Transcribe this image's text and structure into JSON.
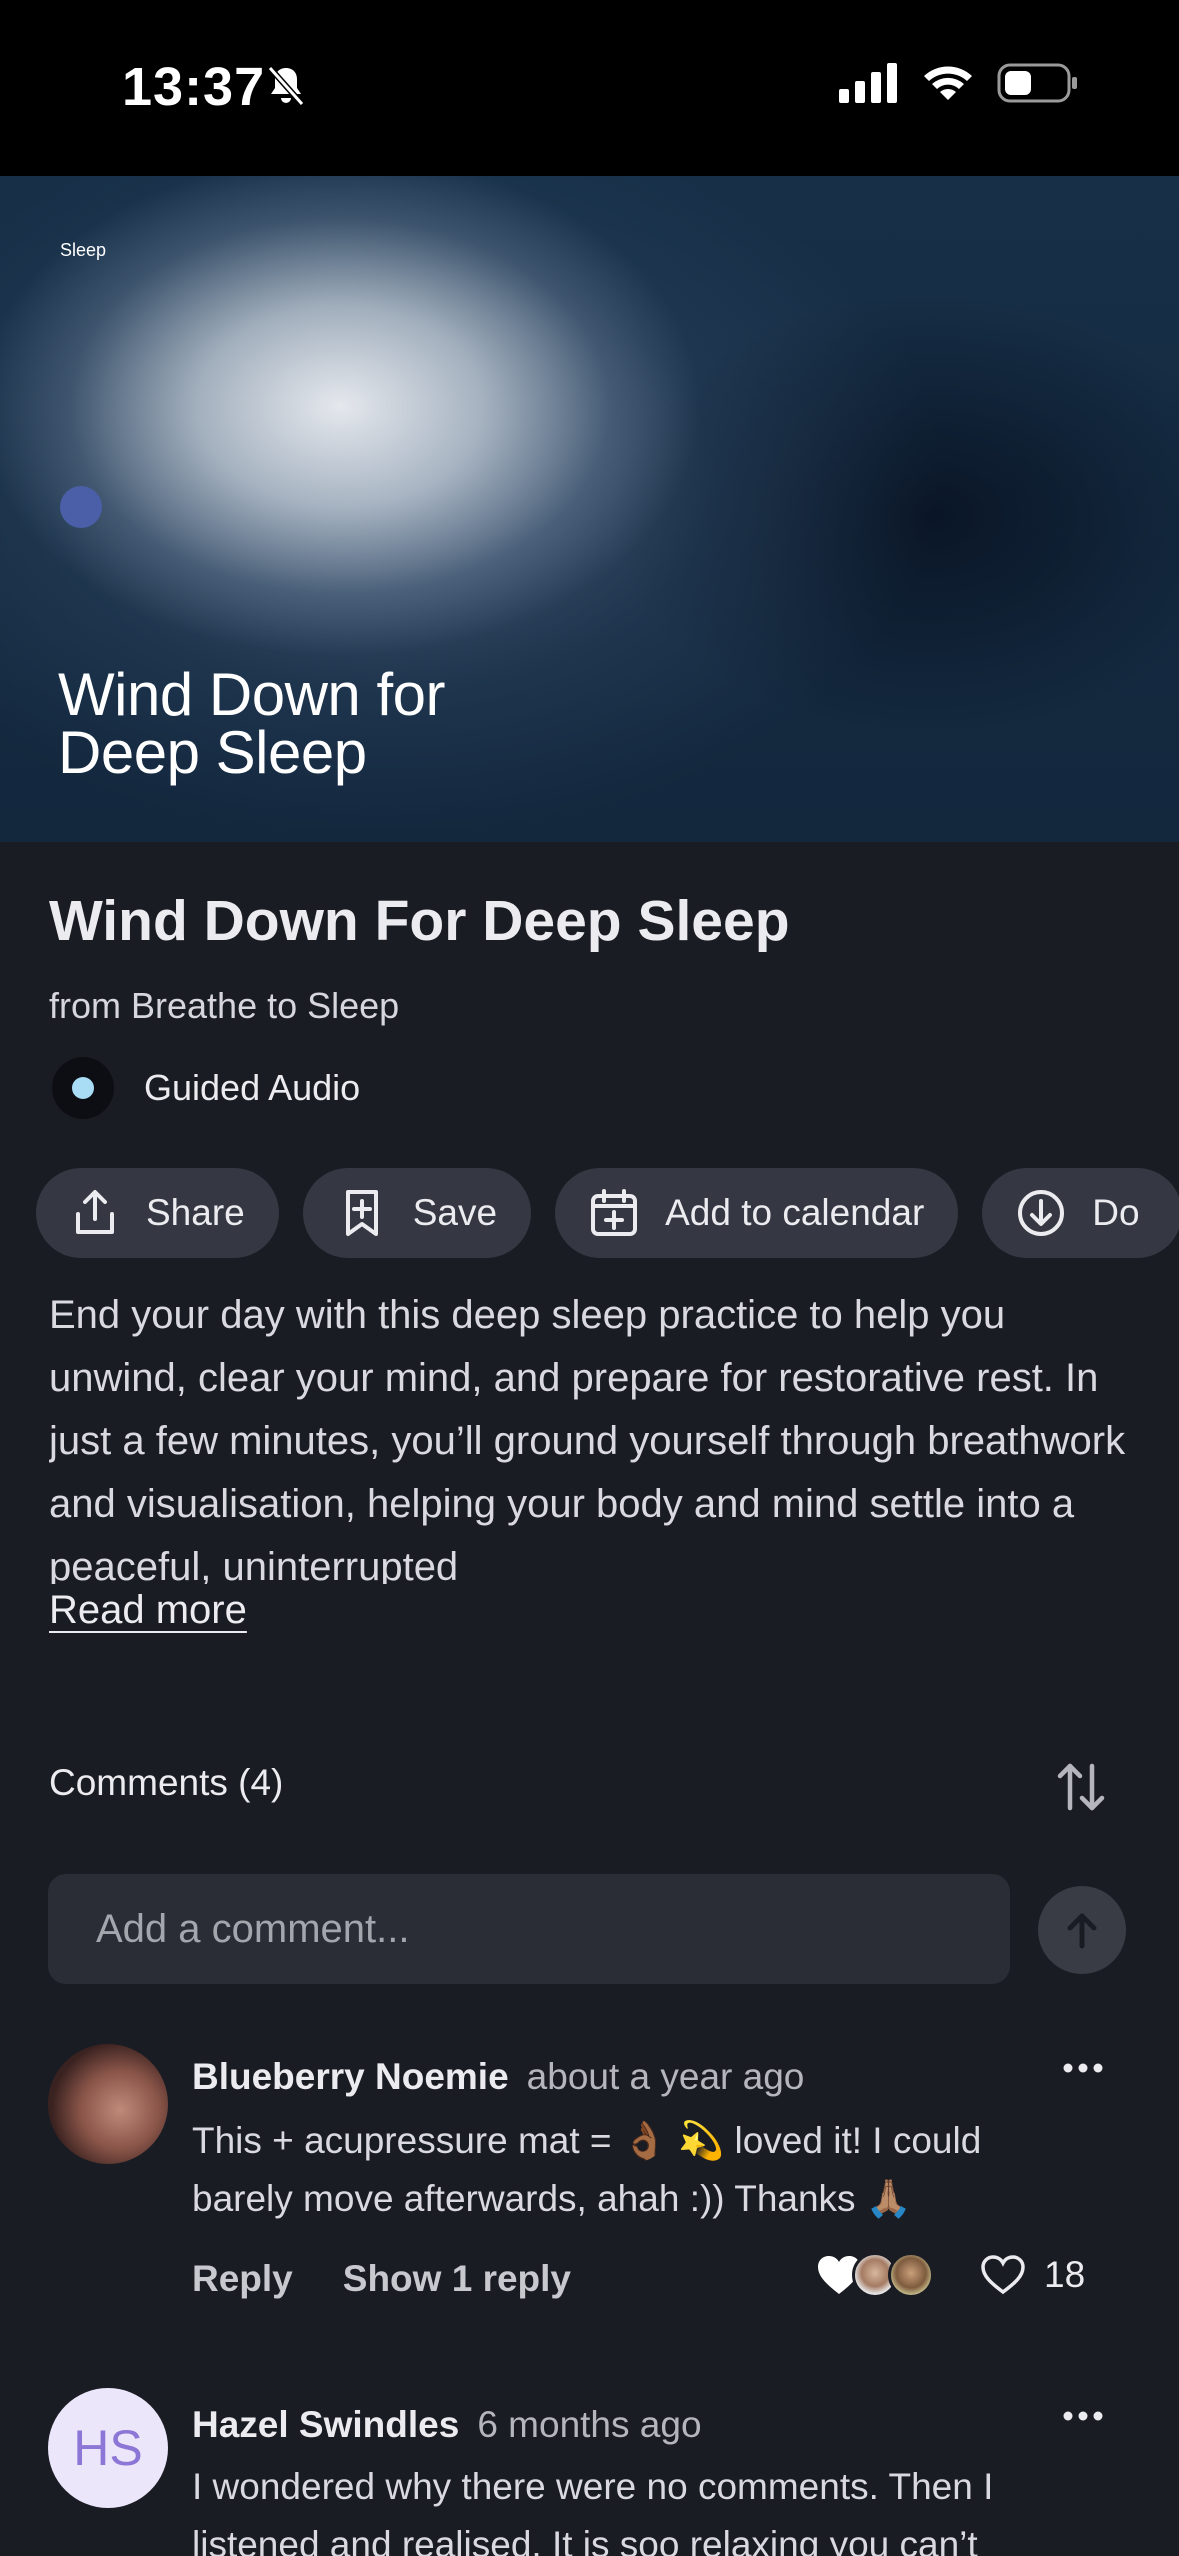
{
  "status_bar": {
    "time": "13:37"
  },
  "hero": {
    "tag": "Sleep",
    "title_line1": "Wind Down for",
    "title_line2": "Deep Sleep"
  },
  "content": {
    "title": "Wind Down For Deep Sleep",
    "source": "from Breathe to Sleep",
    "type_label": "Guided Audio",
    "description": "End your day with this deep sleep practice to help you unwind, clear your mind, and prepare for restorative rest. In just a few minutes, you’ll ground yourself through breathwork and visualisation, helping your body and mind settle into a peaceful, uninterrupted",
    "read_more": "Read more"
  },
  "actions": {
    "share": "Share",
    "save": "Save",
    "calendar": "Add to calendar",
    "download": "Do"
  },
  "comments": {
    "header": "Comments (4)",
    "input_placeholder": "Add a comment...",
    "items": [
      {
        "author": "Blueberry Noemie",
        "time": "about a year ago",
        "text": "This + acupressure mat = 👌🏾 💫  loved it! I could barely move afterwards, ahah :)) Thanks 🙏🏽",
        "reply_label": "Reply",
        "show_replies_label": "Show 1 reply",
        "likes": "18"
      },
      {
        "author": "Hazel Swindles",
        "initials": "HS",
        "time": "6 months ago",
        "text": "I wondered why there were no comments. Then I listened and realised. It is soo relaxing you can’t"
      }
    ]
  }
}
